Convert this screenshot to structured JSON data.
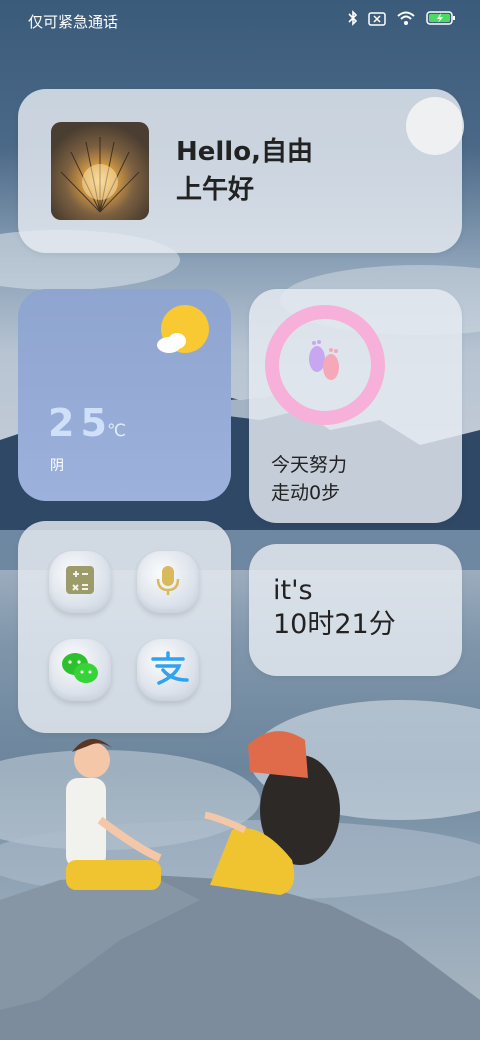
{
  "statusbar": {
    "carrier": "仅可紧急通话",
    "icons": [
      "bluetooth-icon",
      "no-sim-icon",
      "wifi-icon",
      "battery-charging-icon"
    ]
  },
  "greeting": {
    "line1": "Hello,自由",
    "line2": "上午好"
  },
  "weather": {
    "temperature": "25",
    "unit": "℃",
    "condition": "阴",
    "icon": "partly-cloudy-icon"
  },
  "steps": {
    "line1": "今天努力",
    "line2": "走动0步",
    "icon": "footprints-icon",
    "ring_color": "#f7b0d9"
  },
  "apps": [
    {
      "icon": "calculator-icon"
    },
    {
      "icon": "voice-recorder-icon"
    },
    {
      "icon": "wechat-icon"
    },
    {
      "icon": "alipay-icon"
    }
  ],
  "clock": {
    "line1": "it's",
    "line2": "10时21分"
  }
}
